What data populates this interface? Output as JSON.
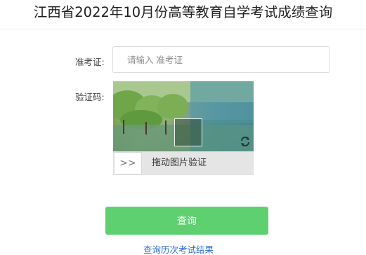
{
  "header": {
    "title": "江西省2022年10月份高等教育自学考试成绩查询"
  },
  "form": {
    "exam_number": {
      "label": "准考证:",
      "placeholder": "请输入 准考证",
      "value": ""
    },
    "captcha": {
      "label": "验证码:",
      "slider_handle_text": ">>",
      "slider_instruction": "拖动图片验证",
      "refresh_icon": "refresh-icon",
      "image_icon": "landscape-puzzle-image"
    },
    "submit_label": "查询",
    "history_link_text": "查询历次考试结果"
  },
  "colors": {
    "primary_button": "#5fd070",
    "link": "#2f6fcf"
  }
}
